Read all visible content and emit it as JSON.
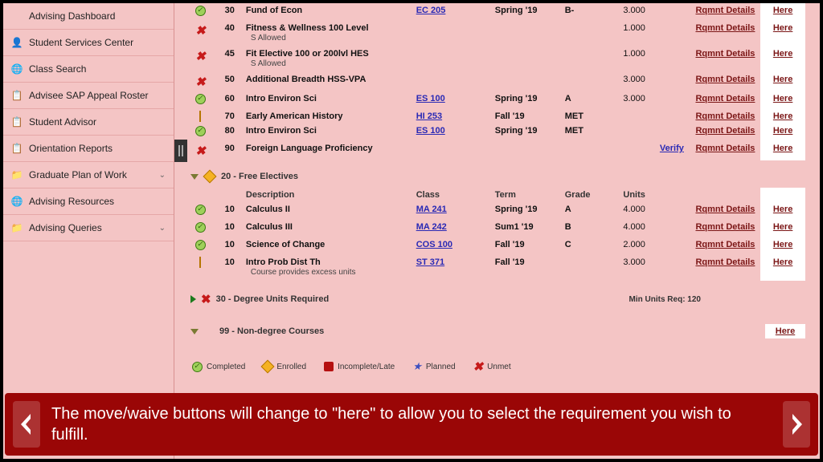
{
  "sidebar": {
    "items": [
      {
        "label": "Advising Dashboard",
        "icon": ""
      },
      {
        "label": "Student Services Center",
        "icon": "person"
      },
      {
        "label": "Class Search",
        "icon": "globe"
      },
      {
        "label": "Advisee SAP Appeal Roster",
        "icon": "list"
      },
      {
        "label": "Student Advisor",
        "icon": "list"
      },
      {
        "label": "Orientation Reports",
        "icon": "list"
      },
      {
        "label": "Graduate Plan of Work",
        "icon": "folder",
        "expandable": true
      },
      {
        "label": "Advising Resources",
        "icon": "globe"
      },
      {
        "label": "Advising Queries",
        "icon": "folder",
        "expandable": true
      }
    ]
  },
  "columns": {
    "desc": "Description",
    "class": "Class",
    "term": "Term",
    "grade": "Grade",
    "units": "Units"
  },
  "rows1": [
    {
      "ico": "ok",
      "seq": "30",
      "desc": "Fund of Econ",
      "class": "EC 205",
      "term": "Spring '19",
      "grade": "B-",
      "units": "3.000",
      "rq": "Rqmnt Details",
      "here": "Here"
    },
    {
      "ico": "un",
      "seq": "40",
      "desc": "Fitness & Wellness 100 Level",
      "note": "S Allowed",
      "units": "1.000",
      "rq": "Rqmnt Details",
      "here": "Here"
    },
    {
      "ico": "un",
      "seq": "45",
      "desc": "Fit Elective 100 or 200lvl HES",
      "note": "S Allowed",
      "units": "1.000",
      "rq": "Rqmnt Details",
      "here": "Here"
    },
    {
      "ico": "un",
      "seq": "50",
      "desc": "Additional Breadth HSS-VPA",
      "units": "3.000",
      "rq": "Rqmnt Details",
      "here": "Here"
    },
    {
      "ico": "ok",
      "seq": "60",
      "desc": "Intro Environ Sci",
      "class": "ES 100",
      "term": "Spring '19",
      "grade": "A",
      "units": "3.000",
      "rq": "Rqmnt Details",
      "here": "Here"
    },
    {
      "ico": "enr",
      "seq": "70",
      "desc": "Early American History",
      "class": "HI 253",
      "term": "Fall '19",
      "grade": "MET",
      "rq": "Rqmnt Details",
      "here": "Here"
    },
    {
      "ico": "ok",
      "seq": "80",
      "desc": "Intro Environ Sci",
      "class": "ES 100",
      "term": "Spring '19",
      "grade": "MET",
      "rq": "Rqmnt Details",
      "here": "Here"
    },
    {
      "ico": "un",
      "seq": "90",
      "desc": "Foreign Language Proficiency",
      "verify": "Verify",
      "rq": "Rqmnt Details",
      "here": "Here"
    }
  ],
  "section2": {
    "title": "20 - Free Electives"
  },
  "rows2": [
    {
      "ico": "ok",
      "seq": "10",
      "desc": "Calculus II",
      "class": "MA 241",
      "term": "Spring '19",
      "grade": "A",
      "units": "4.000",
      "rq": "Rqmnt Details",
      "here": "Here"
    },
    {
      "ico": "ok",
      "seq": "10",
      "desc": "Calculus III",
      "class": "MA 242",
      "term": "Sum1 '19",
      "grade": "B",
      "units": "4.000",
      "rq": "Rqmnt Details",
      "here": "Here"
    },
    {
      "ico": "ok",
      "seq": "10",
      "desc": "Science of Change",
      "class": "COS 100",
      "term": "Fall '19",
      "grade": "C",
      "units": "2.000",
      "rq": "Rqmnt Details",
      "here": "Here"
    },
    {
      "ico": "enr",
      "seq": "10",
      "desc": "Intro Prob Dist Th",
      "note": "Course provides excess units",
      "class": "ST 371",
      "term": "Fall '19",
      "units": "3.000",
      "rq": "Rqmnt Details",
      "here": "Here"
    }
  ],
  "section3": {
    "title": "30 - Degree Units Required",
    "min": "Min Units Req: 120"
  },
  "section4": {
    "title": "99 - Non-degree Courses",
    "here": "Here"
  },
  "legend": {
    "completed": "Completed",
    "enrolled": "Enrolled",
    "incomplete": "Incomplete/Late",
    "planned": "Planned",
    "unmet": "Unmet"
  },
  "caption": "The move/waive buttons will change to \"here\" to allow you to select the requirement you wish to fulfill."
}
